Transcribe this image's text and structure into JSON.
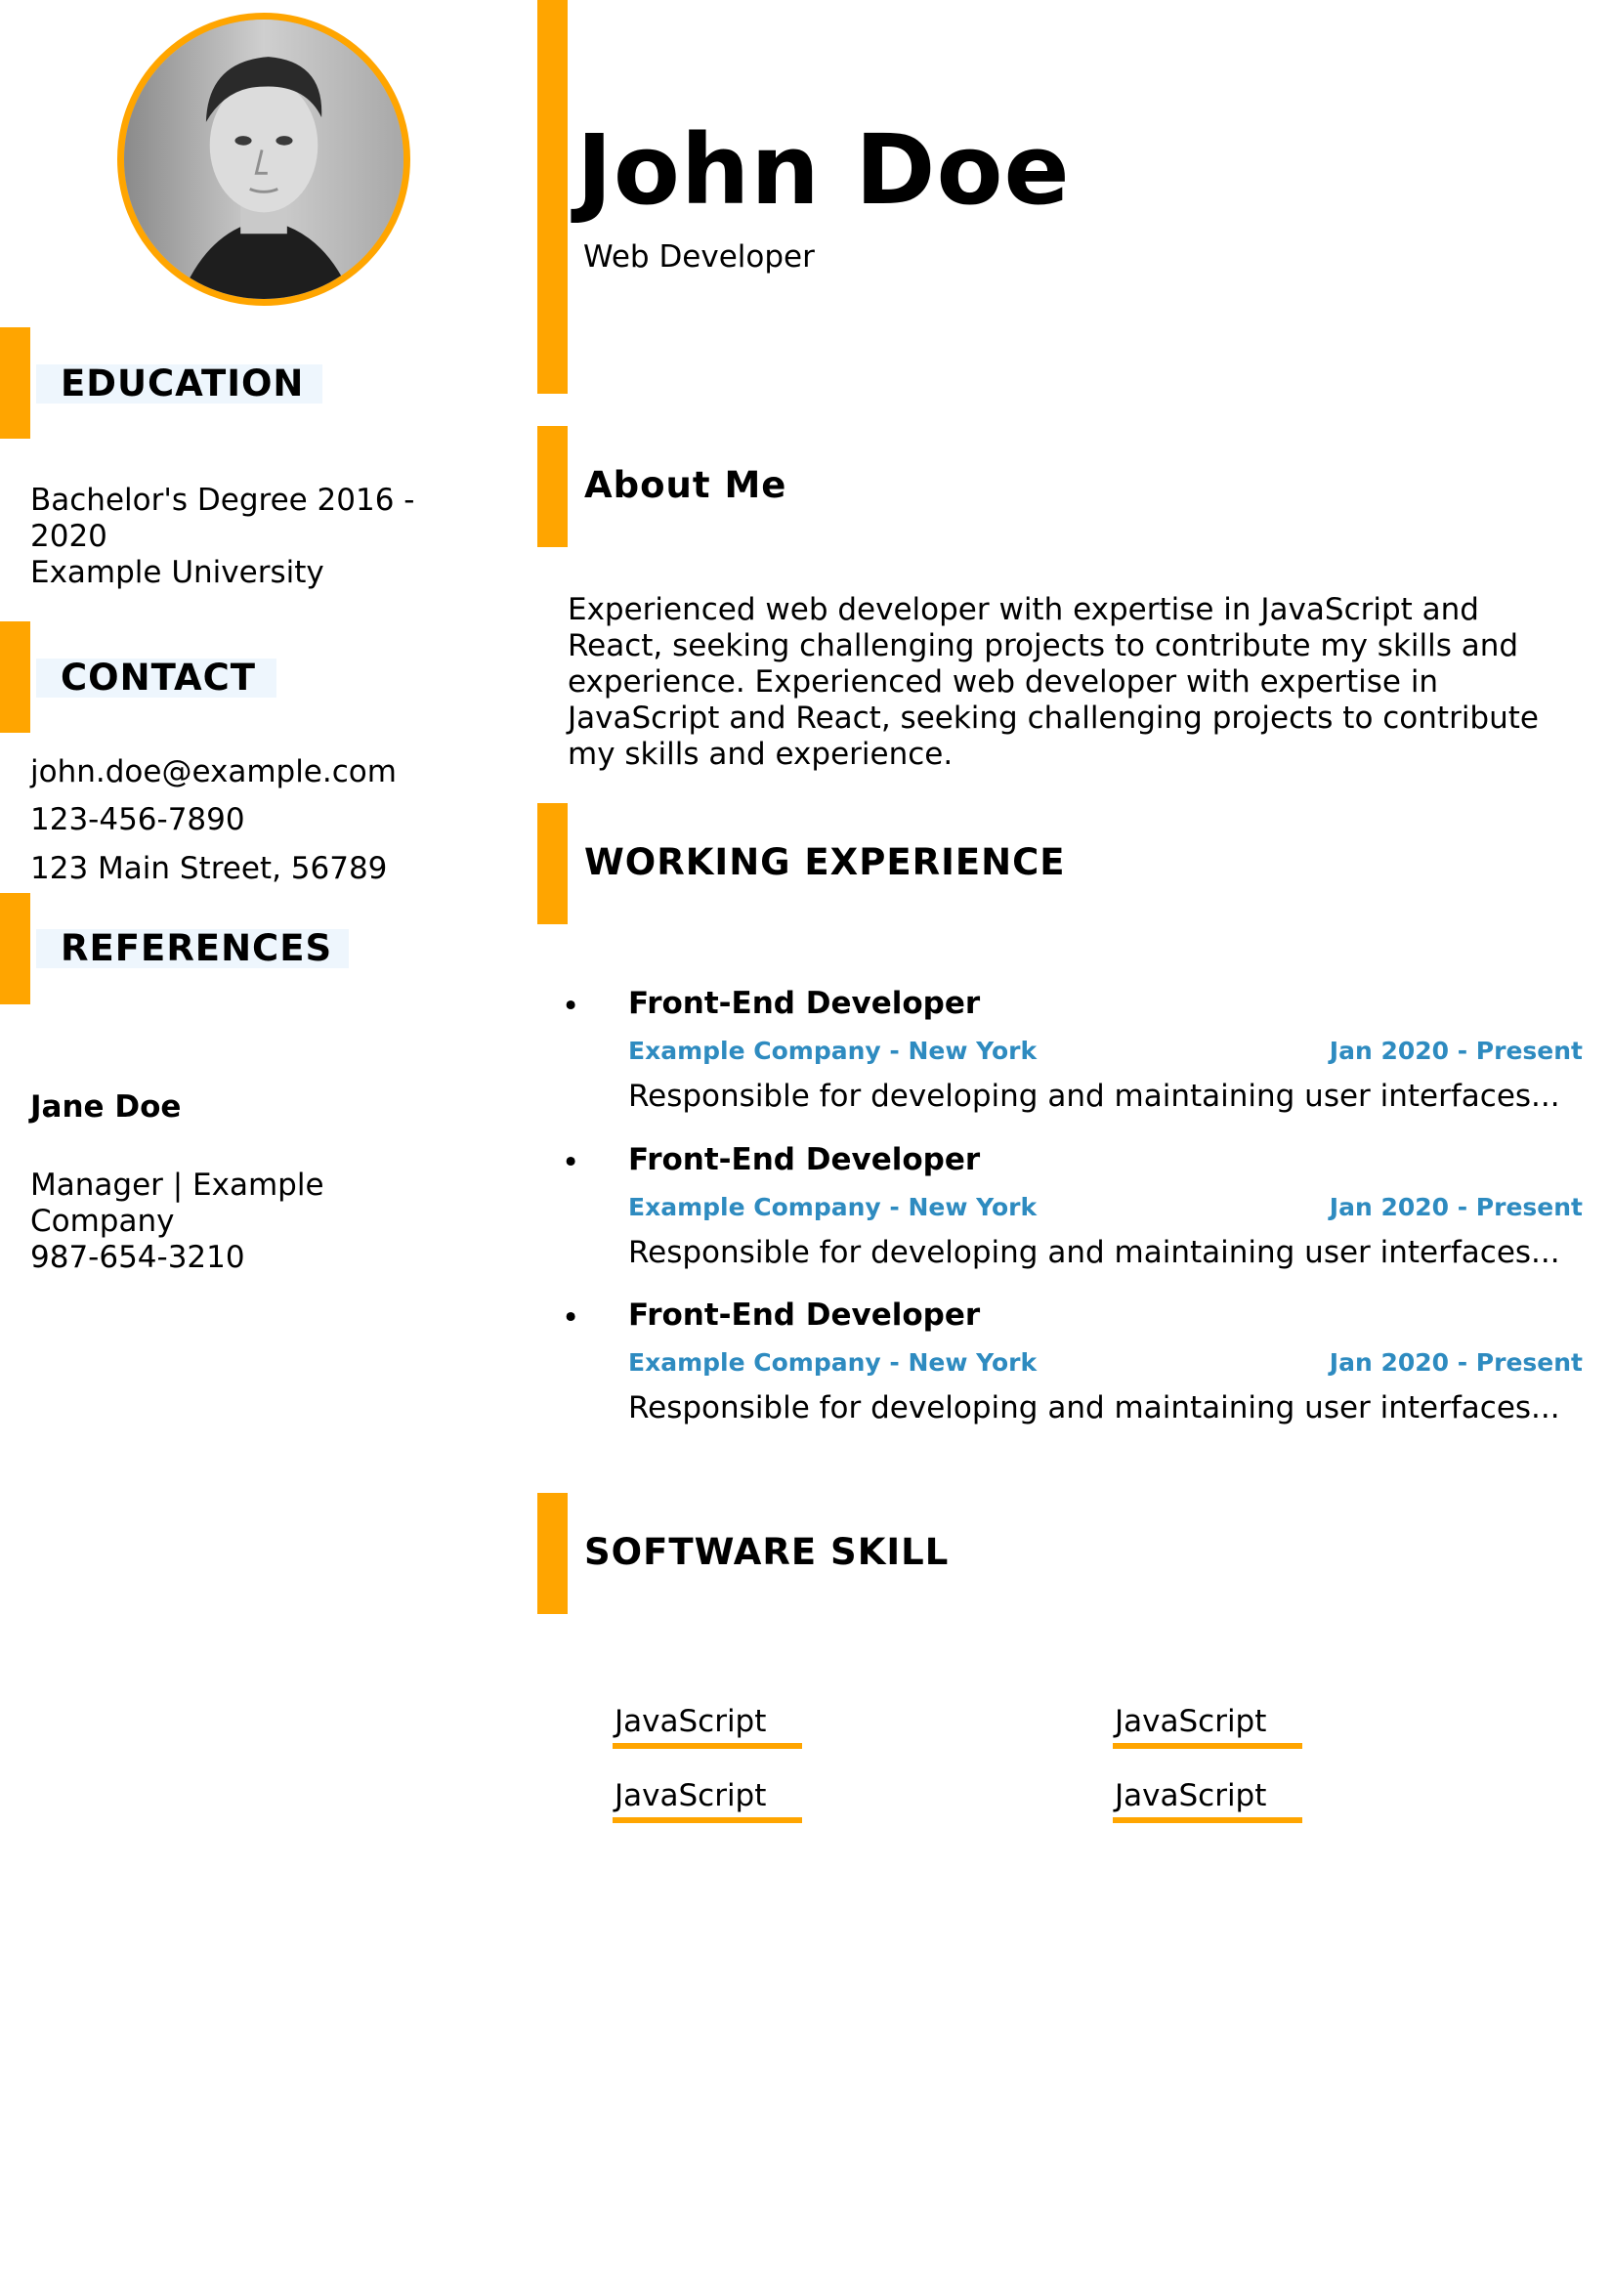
{
  "profile": {
    "name": "John Doe",
    "role": "Web Developer",
    "photo_alt": "Profile photo"
  },
  "sidebar": {
    "education": {
      "title": "EDUCATION",
      "degree_line1": "Bachelor's Degree 2016 -",
      "degree_line2": "2020",
      "school": "Example University"
    },
    "contact": {
      "title": "CONTACT",
      "email": "john.doe@example.com",
      "phone": "123-456-7890",
      "address": "123 Main Street, 56789"
    },
    "references": {
      "title": "REFERENCES",
      "name": "Jane Doe",
      "line1": "Manager | Example",
      "line2": "Company",
      "phone": "987-654-3210"
    }
  },
  "about": {
    "title": "About Me",
    "text": "Experienced web developer with expertise in JavaScript and React, seeking challenging projects to contribute my skills and experience. Experienced web developer with expertise in JavaScript and React, seeking challenging projects to contribute my skills and experience."
  },
  "experience": {
    "title": "WORKING EXPERIENCE",
    "bullet": "•",
    "items": [
      {
        "title": "Front-End Developer",
        "company": "Example Company - New York",
        "dates": "Jan 2020 - Present",
        "desc": "Responsible for developing and maintaining user interfaces..."
      },
      {
        "title": "Front-End Developer",
        "company": "Example Company - New York",
        "dates": "Jan 2020 - Present",
        "desc": "Responsible for developing and maintaining user interfaces..."
      },
      {
        "title": "Front-End Developer",
        "company": "Example Company - New York",
        "dates": "Jan 2020 - Present",
        "desc": "Responsible for developing and maintaining user interfaces..."
      }
    ]
  },
  "skills": {
    "title": "SOFTWARE SKILL",
    "items": [
      "JavaScript",
      "JavaScript",
      "JavaScript",
      "JavaScript"
    ]
  },
  "colors": {
    "accent": "#FFA500",
    "link_blue": "#2E8BC0",
    "title_bg": "#EEF6FD"
  }
}
